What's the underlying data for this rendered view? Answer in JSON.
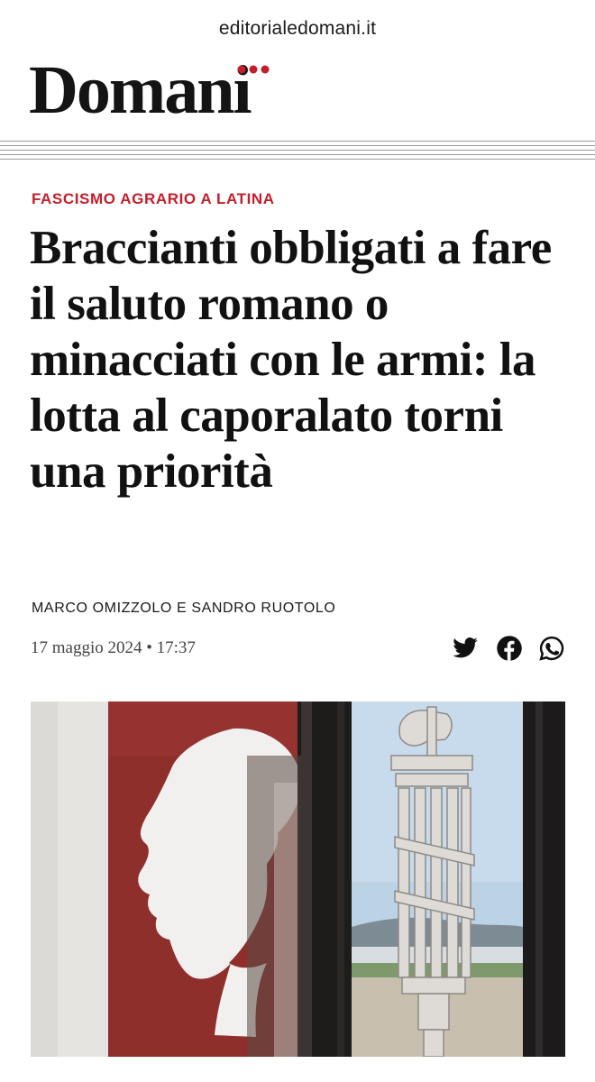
{
  "browser": {
    "url": "editorialedomani.it"
  },
  "site": {
    "logo_text": "Domani",
    "logo_accent_color": "#c41e2a"
  },
  "article": {
    "kicker": "FASCISMO AGRARIO A LATINA",
    "headline": "Braccianti obbligati a fare il saluto romano o minacciati con le armi: la lotta al caporalato torni una priorità",
    "byline": "MARCO OMIZZOLO E SANDRO RUOTOLO",
    "date": "17 maggio 2024",
    "separator": "•",
    "time": "17:37"
  },
  "share": {
    "icons": [
      "twitter-icon",
      "facebook-icon",
      "whatsapp-icon"
    ]
  },
  "hero_image": {
    "subject": "Mussolini profile stencil on red wall and fasces symbol on window glass"
  },
  "colors": {
    "accent": "#c41e2a",
    "text": "#111111",
    "muted": "#444444"
  }
}
